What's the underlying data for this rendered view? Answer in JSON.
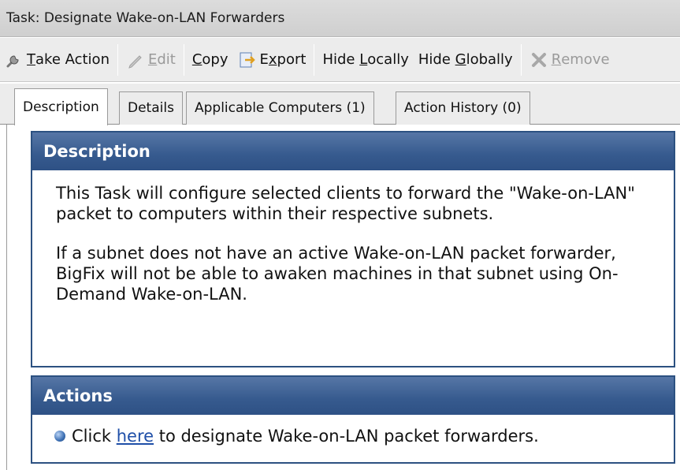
{
  "window": {
    "title": "Task: Designate Wake-on-LAN Forwarders"
  },
  "toolbar": {
    "take_action": {
      "prefix": "",
      "underlined": "T",
      "rest": "ake Action"
    },
    "edit": {
      "prefix": "",
      "underlined": "E",
      "rest": "dit"
    },
    "copy": {
      "prefix": "",
      "underlined": "C",
      "rest": "opy"
    },
    "export": {
      "prefix": "",
      "underlined": "x",
      "prefix_text": "E",
      "rest": "port"
    },
    "hide_locally": {
      "prefix": "Hide ",
      "underlined": "L",
      "rest": "ocally"
    },
    "hide_globally": {
      "prefix": "Hide ",
      "underlined": "G",
      "rest": "lobally"
    },
    "remove": {
      "prefix": "",
      "underlined": "R",
      "rest": "emove"
    }
  },
  "tabs": [
    {
      "label": "Description"
    },
    {
      "label": "Details"
    },
    {
      "label": "Applicable Computers (1)"
    },
    {
      "label": "Action History (0)"
    }
  ],
  "description_panel": {
    "header": "Description",
    "paragraph1": "This Task will configure selected clients to forward the \"Wake-on-LAN\" packet to computers within their respective subnets.",
    "paragraph2": "If a subnet does not have an active Wake-on-LAN packet forwarder, BigFix will not be able to awaken machines in that subnet using On-Demand Wake-on-LAN."
  },
  "actions_panel": {
    "header": "Actions",
    "before_link": "Click ",
    "link_text": "here",
    "after_link": " to designate Wake-on-LAN packet forwarders."
  },
  "colors": {
    "panel_header": "#365a8e",
    "panel_border": "#2c5181",
    "link": "#1f4fa8"
  },
  "icons": [
    "take-action-wrench-icon",
    "edit-pencil-icon",
    "export-icon",
    "remove-x-icon",
    "bullet-icon"
  ]
}
